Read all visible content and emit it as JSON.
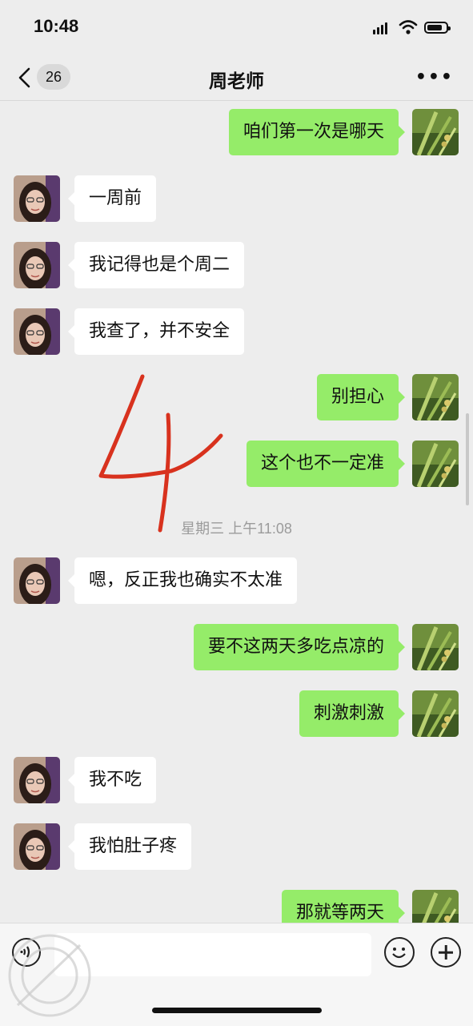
{
  "status_bar": {
    "time": "10:48"
  },
  "nav": {
    "back_count": "26",
    "title": "周老师",
    "more": "•••"
  },
  "messages": [
    {
      "side": "right",
      "text": "咱们第一次是哪天"
    },
    {
      "side": "left",
      "text": "一周前"
    },
    {
      "side": "left",
      "text": "我记得也是个周二"
    },
    {
      "side": "left",
      "text": "我查了，并不安全"
    },
    {
      "side": "right",
      "text": "别担心"
    },
    {
      "side": "right",
      "text": "这个也不一定准"
    },
    {
      "side": "left",
      "text": "嗯，反正我也确实不太准"
    },
    {
      "side": "right",
      "text": "要不这两天多吃点凉的"
    },
    {
      "side": "right",
      "text": "刺激刺激"
    },
    {
      "side": "left",
      "text": "我不吃"
    },
    {
      "side": "left",
      "text": "我怕肚子疼"
    },
    {
      "side": "right",
      "text": "那就等两天"
    }
  ],
  "timestamp": "星期三 上午11:08",
  "annotation": "4",
  "colors": {
    "sent_bubble": "#95ec69",
    "received_bubble": "#ffffff",
    "background": "#ededed",
    "annotation": "#d8321e"
  },
  "input_bar": {
    "value": "",
    "icons": [
      "voice-icon",
      "emoji-icon",
      "plus-icon"
    ]
  }
}
